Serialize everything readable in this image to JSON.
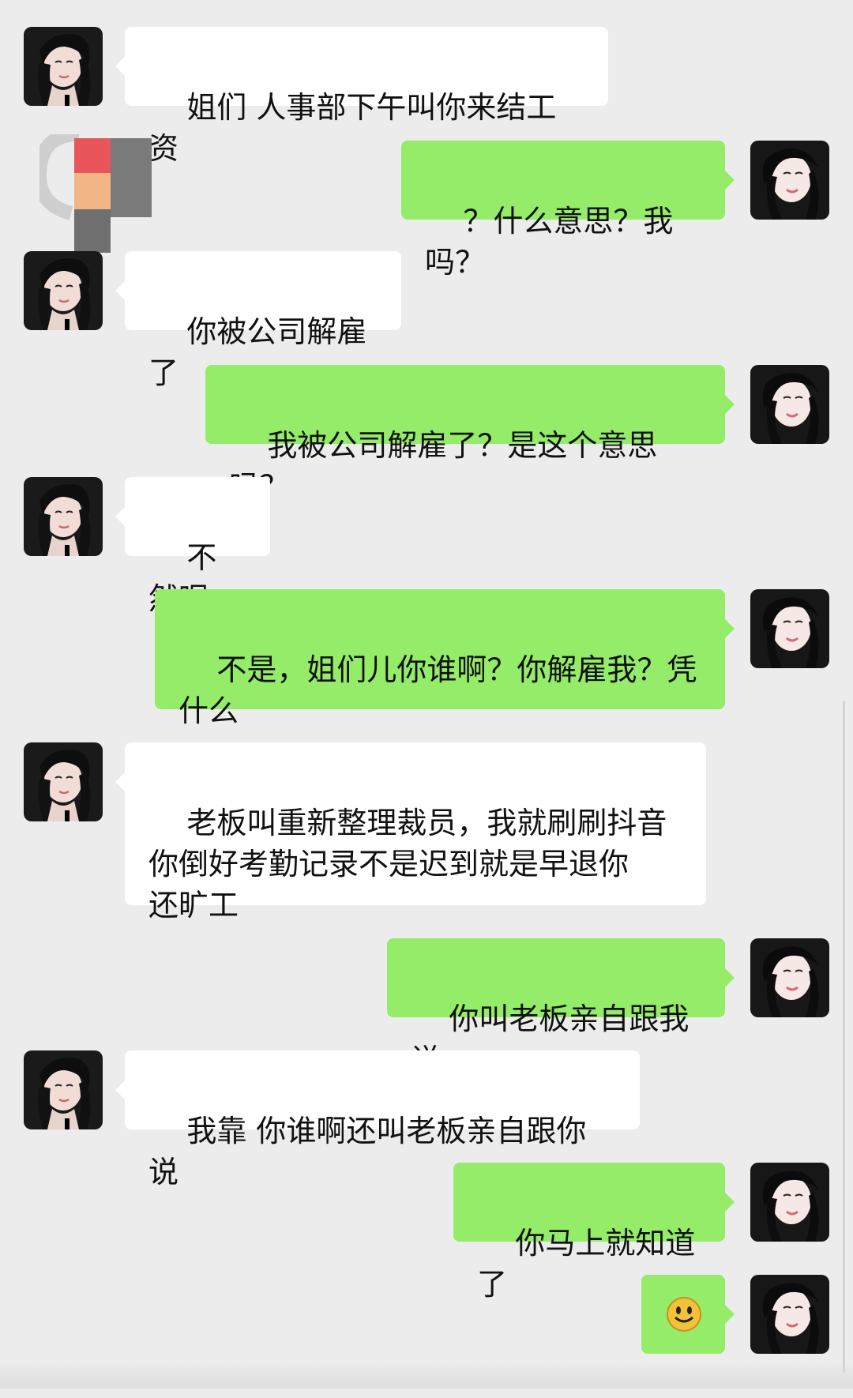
{
  "messages": [
    {
      "side": "left",
      "text": "姐们 人事部下午叫你来结工资"
    },
    {
      "side": "right",
      "text": "？什么意思？我吗？"
    },
    {
      "side": "left",
      "text": "你被公司解雇了"
    },
    {
      "side": "right",
      "text": "我被公司解雇了？是这个意思吗？"
    },
    {
      "side": "left",
      "text": "不然呢"
    },
    {
      "side": "right",
      "text": "不是，姐们儿你谁啊？你解雇我？凭什么"
    },
    {
      "side": "left",
      "text": "老板叫重新整理裁员，我就刷刷抖音\n你倒好考勤记录不是迟到就是早退你\n还旷工"
    },
    {
      "side": "right",
      "text": "你叫老板亲自跟我说"
    },
    {
      "side": "left",
      "text": "我靠 你谁啊还叫老板亲自跟你说"
    },
    {
      "side": "right",
      "text": "你马上就知道了"
    }
  ],
  "colors": {
    "background": "#ececec",
    "bubble_right": "#95ec69",
    "bubble_left": "#ffffff",
    "text": "#111111"
  },
  "icons": {
    "smile": "smile-emoji-icon",
    "avatar_left": "avatar-woman-left",
    "avatar_right": "avatar-woman-right"
  }
}
